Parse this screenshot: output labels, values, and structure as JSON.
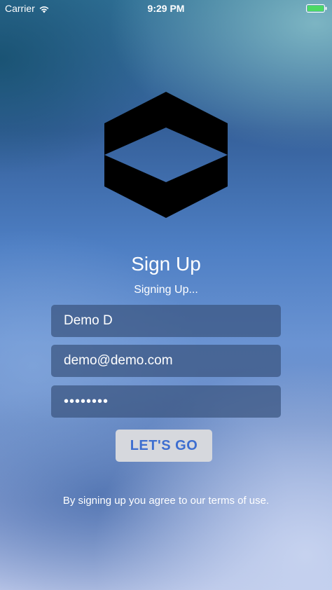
{
  "status_bar": {
    "carrier": "Carrier",
    "time": "9:29 PM",
    "battery_color": "#4cd964",
    "icons": [
      "wifi-icon",
      "battery-icon"
    ]
  },
  "logo": {
    "icon": "hexagon-logo-icon",
    "color": "#000000"
  },
  "header": {
    "title": "Sign Up",
    "subtitle": "Signing Up..."
  },
  "form": {
    "name_value": "Demo D",
    "email_value": "demo@demo.com",
    "password_display": "••••••••",
    "field_color": "#3a5480"
  },
  "actions": {
    "go_label": "LET'S GO",
    "go_text_color": "#3d6ed0"
  },
  "footer": {
    "terms_text": "By signing up you agree to our terms of use."
  }
}
